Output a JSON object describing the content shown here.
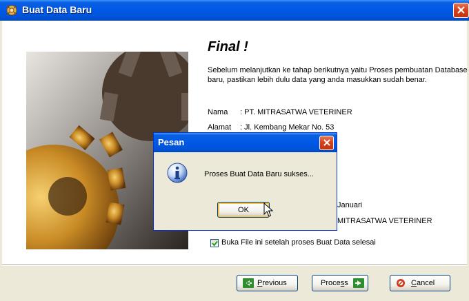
{
  "window": {
    "title": "Buat Data Baru"
  },
  "page": {
    "heading": "Final !",
    "description": "Sebelum melanjutkan ke tahap berikutnya yaitu Proses pembuatan Database baru, pastikan lebih dulu data yang anda masukkan sudah benar.",
    "fields": [
      {
        "label": "Nama",
        "value": ": PT. MITRASATWA VETERINER"
      },
      {
        "label": "Alamat",
        "value": ": Jl. Kembang Mekar No. 53"
      }
    ],
    "partial_text": [
      "Januari",
      "MITRASATWA VETERINER"
    ],
    "checkbox": {
      "label": "Buka File ini setelah proses Buat Data selesai",
      "checked": true
    }
  },
  "buttons": {
    "previous": {
      "label_u": "P",
      "label_rest": "revious"
    },
    "process": {
      "label_pre": "Proce",
      "label_u": "s",
      "label_post": "s"
    },
    "cancel": {
      "label_u": "C",
      "label_rest": "ancel"
    }
  },
  "message_box": {
    "title": "Pesan",
    "text": "Proses Buat Data Baru sukses...",
    "ok_label": "OK"
  },
  "icons": [
    "app-icon",
    "close-icon",
    "gear-image",
    "info-icon",
    "arrow-left-icon",
    "arrow-right-icon",
    "cancel-icon",
    "mouse-cursor"
  ],
  "colors": {
    "titlebar": "#0058e6",
    "close": "#d8421b",
    "dialog_bg": "#ece9d8"
  }
}
